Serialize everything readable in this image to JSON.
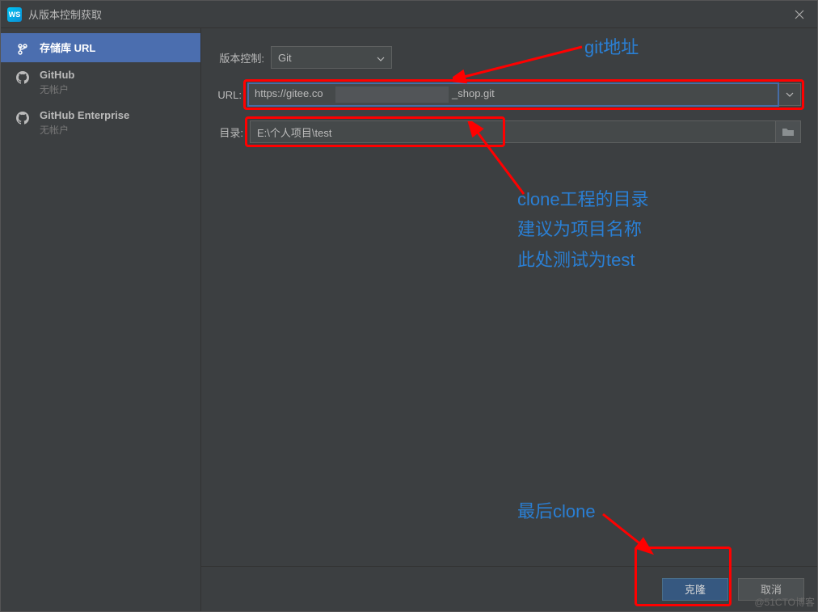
{
  "window": {
    "title": "从版本控制获取"
  },
  "sidebar": {
    "items": [
      {
        "label": "存储库 URL",
        "sub": ""
      },
      {
        "label": "GitHub",
        "sub": "无帐户"
      },
      {
        "label": "GitHub Enterprise",
        "sub": "无帐户"
      }
    ]
  },
  "form": {
    "vcs_label": "版本控制:",
    "vcs_value": "Git",
    "url_label": "URL:",
    "url_value_prefix": "https://gitee.co",
    "url_value_suffix": "_shop.git",
    "dir_label": "目录:",
    "dir_value": "E:\\个人项目\\test"
  },
  "buttons": {
    "clone": "克隆",
    "cancel": "取消"
  },
  "annotations": {
    "a1": "git地址",
    "a2_line1": "clone工程的目录",
    "a2_line2": "建议为项目名称",
    "a2_line3": "此处测试为test",
    "a3": "最后clone"
  },
  "watermark": "@51CTO博客"
}
